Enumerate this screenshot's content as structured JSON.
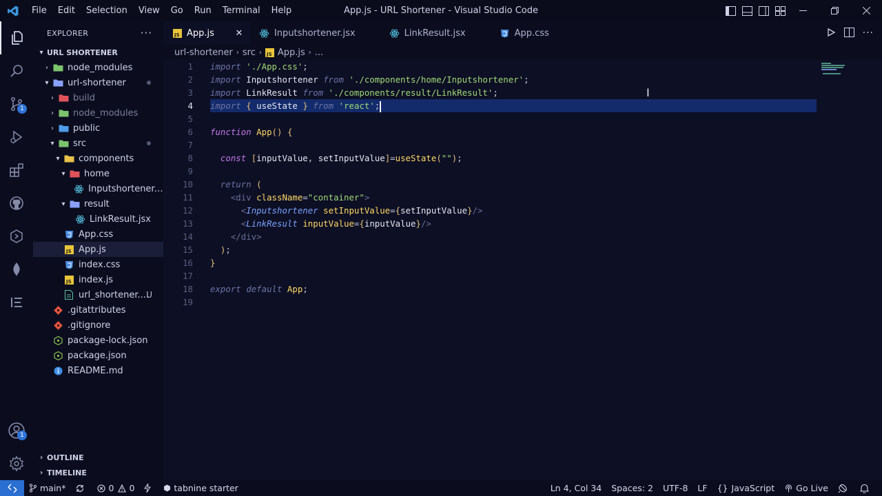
{
  "window": {
    "title": "App.js - URL Shortener - Visual Studio Code",
    "menu": [
      "File",
      "Edit",
      "Selection",
      "View",
      "Go",
      "Run",
      "Terminal",
      "Help"
    ]
  },
  "activity_bar": {
    "items": [
      "explorer-icon",
      "search-icon",
      "source-control-icon",
      "run-debug-icon",
      "extensions-icon",
      "github-icon",
      "remote-icon",
      "mongodb-icon",
      "outline-list-icon"
    ],
    "source_control_badge": "1",
    "accounts_badge": "1"
  },
  "sidebar": {
    "title": "EXPLORER",
    "more": "···",
    "root": "URL SHORTENER",
    "tree": [
      {
        "label": "node_modules",
        "depth": 1,
        "type": "folder-green",
        "chev": "right"
      },
      {
        "label": "url-shortener",
        "depth": 1,
        "type": "folder",
        "chev": "down",
        "dot": true
      },
      {
        "label": "build",
        "depth": 2,
        "type": "folder-red",
        "chev": "right",
        "dim": true
      },
      {
        "label": "node_modules",
        "depth": 2,
        "type": "folder-green",
        "chev": "right",
        "dim": true
      },
      {
        "label": "public",
        "depth": 2,
        "type": "folder-blue",
        "chev": "right"
      },
      {
        "label": "src",
        "depth": 2,
        "type": "folder-green",
        "chev": "down",
        "dot": true
      },
      {
        "label": "components",
        "depth": 3,
        "type": "folder-yellow",
        "chev": "down"
      },
      {
        "label": "home",
        "depth": 4,
        "type": "folder-red",
        "chev": "down"
      },
      {
        "label": "Inputshortener.j...",
        "depth": 5,
        "type": "react"
      },
      {
        "label": "result",
        "depth": 4,
        "type": "folder",
        "chev": "down"
      },
      {
        "label": "LinkResult.jsx",
        "depth": 5,
        "type": "react"
      },
      {
        "label": "App.css",
        "depth": 3,
        "type": "css"
      },
      {
        "label": "App.js",
        "depth": 3,
        "type": "js",
        "selected": true
      },
      {
        "label": "index.css",
        "depth": 3,
        "type": "css"
      },
      {
        "label": "index.js",
        "depth": 3,
        "type": "js"
      },
      {
        "label": "url_shortener....",
        "depth": 3,
        "type": "doc",
        "modified": "U"
      },
      {
        "label": ".gitattributes",
        "depth": 1,
        "type": "git"
      },
      {
        "label": ".gitignore",
        "depth": 1,
        "type": "git"
      },
      {
        "label": "package-lock.json",
        "depth": 1,
        "type": "npm"
      },
      {
        "label": "package.json",
        "depth": 1,
        "type": "npm"
      },
      {
        "label": "README.md",
        "depth": 1,
        "type": "info"
      }
    ],
    "outline": "OUTLINE",
    "timeline": "TIMELINE"
  },
  "tabs": [
    {
      "label": "App.js",
      "type": "js",
      "active": true,
      "close": "✕"
    },
    {
      "label": "Inputshortener.jsx",
      "type": "react"
    },
    {
      "label": "LinkResult.jsx",
      "type": "react"
    },
    {
      "label": "App.css",
      "type": "css"
    }
  ],
  "breadcrumb": [
    "url-shortener",
    "src",
    "App.js",
    "..."
  ],
  "editor": {
    "current_line": 4,
    "lines": [
      [
        [
          "kwd",
          "import"
        ],
        [
          "pl",
          " "
        ],
        [
          "str",
          "'./App.css'"
        ],
        [
          "pl",
          ";"
        ]
      ],
      [
        [
          "kwd",
          "import"
        ],
        [
          "pl",
          " "
        ],
        [
          "id",
          "Inputshortener"
        ],
        [
          "pl",
          " "
        ],
        [
          "kwd",
          "from"
        ],
        [
          "pl",
          " "
        ],
        [
          "str",
          "'./components/home/Inputshortener'"
        ],
        [
          "pl",
          ";"
        ]
      ],
      [
        [
          "kwd",
          "import"
        ],
        [
          "pl",
          " "
        ],
        [
          "id",
          "LinkResult"
        ],
        [
          "pl",
          " "
        ],
        [
          "kwd",
          "from"
        ],
        [
          "pl",
          " "
        ],
        [
          "str",
          "'./components/result/LinkResult'"
        ],
        [
          "pl",
          ";"
        ]
      ],
      [
        [
          "kwd",
          "import"
        ],
        [
          "pl",
          " "
        ],
        [
          "br",
          "{"
        ],
        [
          "pl",
          " "
        ],
        [
          "id",
          "useState"
        ],
        [
          "pl",
          " "
        ],
        [
          "br",
          "}"
        ],
        [
          "pl",
          " "
        ],
        [
          "kwd",
          "from"
        ],
        [
          "pl",
          " "
        ],
        [
          "str",
          "'react'"
        ],
        [
          "pl",
          ";"
        ]
      ],
      [],
      [
        [
          "kw",
          "function"
        ],
        [
          "pl",
          " "
        ],
        [
          "fn",
          "App"
        ],
        [
          "br",
          "()"
        ],
        [
          "pl",
          " "
        ],
        [
          "br",
          "{"
        ]
      ],
      [],
      [
        [
          "pl",
          "  "
        ],
        [
          "kw",
          "const"
        ],
        [
          "pl",
          " "
        ],
        [
          "br",
          "["
        ],
        [
          "id",
          "inputValue"
        ],
        [
          "pl",
          ", "
        ],
        [
          "id",
          "setInputValue"
        ],
        [
          "br",
          "]"
        ],
        [
          "pl",
          "="
        ],
        [
          "fn",
          "useState"
        ],
        [
          "br",
          "("
        ],
        [
          "str",
          "\"\""
        ],
        [
          "br",
          ")"
        ],
        [
          "pl",
          ";"
        ]
      ],
      [],
      [
        [
          "pl",
          "  "
        ],
        [
          "kwd",
          "return"
        ],
        [
          "pl",
          " "
        ],
        [
          "br",
          "("
        ]
      ],
      [
        [
          "pl",
          "    "
        ],
        [
          "tag",
          "<div"
        ],
        [
          "pl",
          " "
        ],
        [
          "attr",
          "className"
        ],
        [
          "pl",
          "="
        ],
        [
          "str",
          "\"container\""
        ],
        [
          "tag",
          ">"
        ]
      ],
      [
        [
          "pl",
          "      "
        ],
        [
          "tag",
          "<"
        ],
        [
          "cmp",
          "Inputshortener"
        ],
        [
          "pl",
          " "
        ],
        [
          "attr",
          "setInputValue"
        ],
        [
          "pl",
          "="
        ],
        [
          "br",
          "{"
        ],
        [
          "id",
          "setInputValue"
        ],
        [
          "br",
          "}"
        ],
        [
          "tag",
          "/>"
        ]
      ],
      [
        [
          "pl",
          "      "
        ],
        [
          "tag",
          "<"
        ],
        [
          "cmp",
          "LinkResult"
        ],
        [
          "pl",
          " "
        ],
        [
          "attr",
          "inputValue"
        ],
        [
          "pl",
          "="
        ],
        [
          "br",
          "{"
        ],
        [
          "id",
          "inputValue"
        ],
        [
          "br",
          "}"
        ],
        [
          "tag",
          "/>"
        ]
      ],
      [
        [
          "pl",
          "    "
        ],
        [
          "tag",
          "</div>"
        ]
      ],
      [
        [
          "pl",
          "  "
        ],
        [
          "br",
          ")"
        ],
        [
          "pl",
          ";"
        ]
      ],
      [
        [
          "br",
          "}"
        ]
      ],
      [],
      [
        [
          "kwd",
          "export"
        ],
        [
          "pl",
          " "
        ],
        [
          "kwd",
          "default"
        ],
        [
          "pl",
          " "
        ],
        [
          "fn",
          "App"
        ],
        [
          "pl",
          ";"
        ]
      ],
      []
    ]
  },
  "status": {
    "branch": "main*",
    "errors": "0",
    "warnings": "0",
    "tabnine": "tabnine starter",
    "position": "Ln 4, Col 34",
    "spaces": "Spaces: 2",
    "encoding": "UTF-8",
    "eol": "LF",
    "language": "JavaScript",
    "live": "Go Live",
    "language_icon": "{}"
  },
  "colors": {
    "accent": "#2a6fd1",
    "background": "#0d0f24",
    "line_highlight": "#132b6b"
  }
}
